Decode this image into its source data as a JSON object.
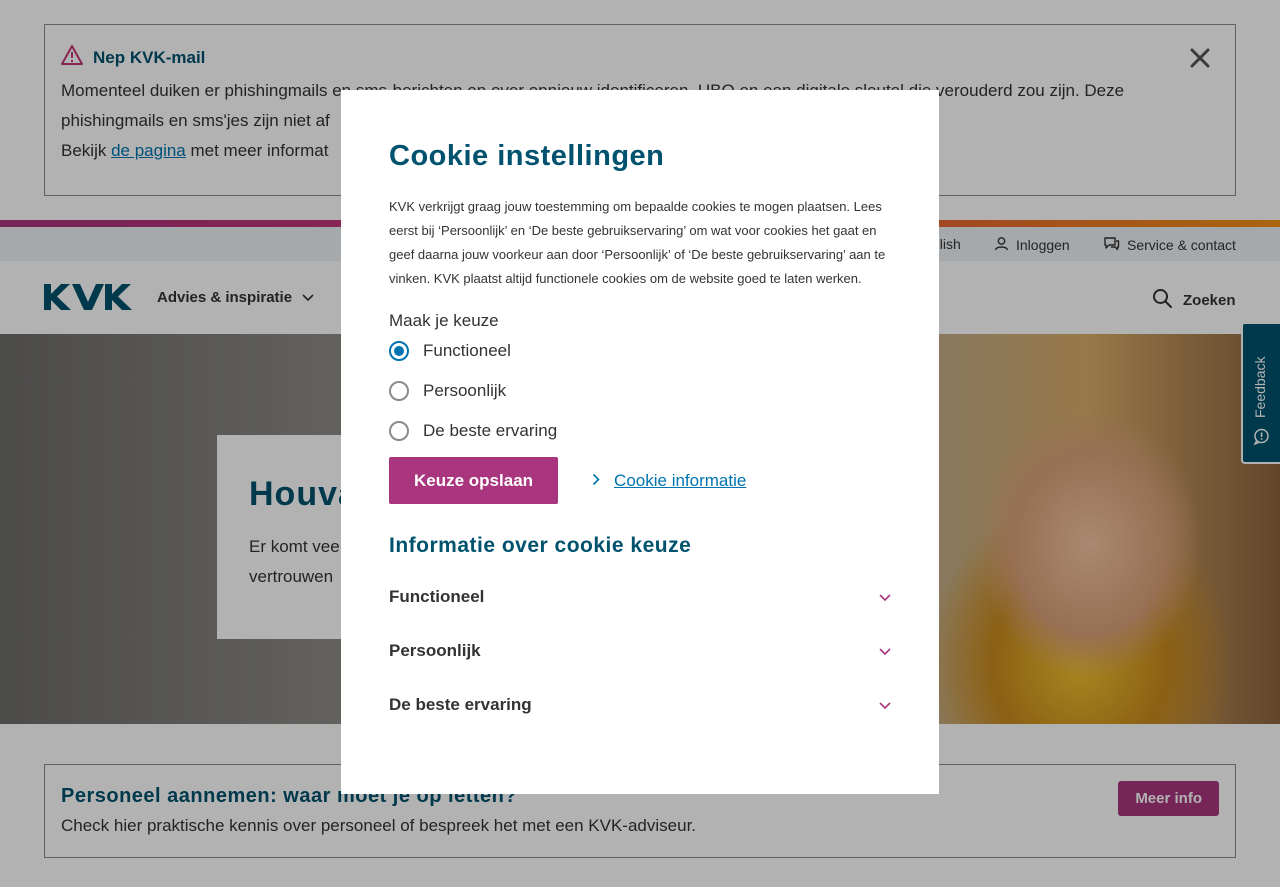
{
  "alert": {
    "title": "Nep KVK-mail",
    "line1": "Momenteel duiken er phishingmails en sms-berichten op over opnieuw identificeren, UBO en een digitale sleutel die verouderd zou zijn. Deze",
    "line2": "phishingmails en sms'jes zijn niet af",
    "line3_prefix": "Bekijk ",
    "line3_link": "de pagina",
    "line3_suffix": " met meer informat",
    "close_icon": "close-icon"
  },
  "utility_nav": {
    "english": "glish",
    "login": "Inloggen",
    "service": "Service & contact"
  },
  "main_nav": {
    "logo": "KVK",
    "advies": "Advies & inspiratie",
    "search": "Zoeken"
  },
  "hero": {
    "title": "Houva",
    "text_line1": "Er komt vee",
    "text_line2": "vertrouwen"
  },
  "feedback": {
    "label": "Feedback"
  },
  "promo": {
    "title": "Personeel aannemen: waar moet je op letten?",
    "text": "Check hier praktische kennis over personeel of bespreek het met een KVK-adviseur.",
    "button": "Meer info"
  },
  "cookie_modal": {
    "title": "Cookie instellingen",
    "intro": "KVK verkrijgt graag jouw toestemming om bepaalde cookies te mogen plaatsen. Lees eerst bij ‘Persoonlijk’ en ‘De beste gebruikservaring’ om wat voor cookies het gaat en geef daarna jouw voorkeur aan door ‘Persoonlijk’ of ‘De beste gebruikservaring’ aan te vinken. KVK plaatst altijd functionele cookies om de website goed te laten werken.",
    "choice_label": "Maak je keuze",
    "options": [
      "Functioneel",
      "Persoonlijk",
      "De beste ervaring"
    ],
    "selected": "Functioneel",
    "save_button": "Keuze opslaan",
    "info_link": "Cookie informatie",
    "info_title": "Informatie over cookie keuze",
    "accordion": [
      "Functioneel",
      "Persoonlijk",
      "De beste ervaring"
    ]
  },
  "colors": {
    "brand_blue": "#00526e",
    "link_blue": "#0074b0",
    "accent_purple": "#a8357d"
  }
}
